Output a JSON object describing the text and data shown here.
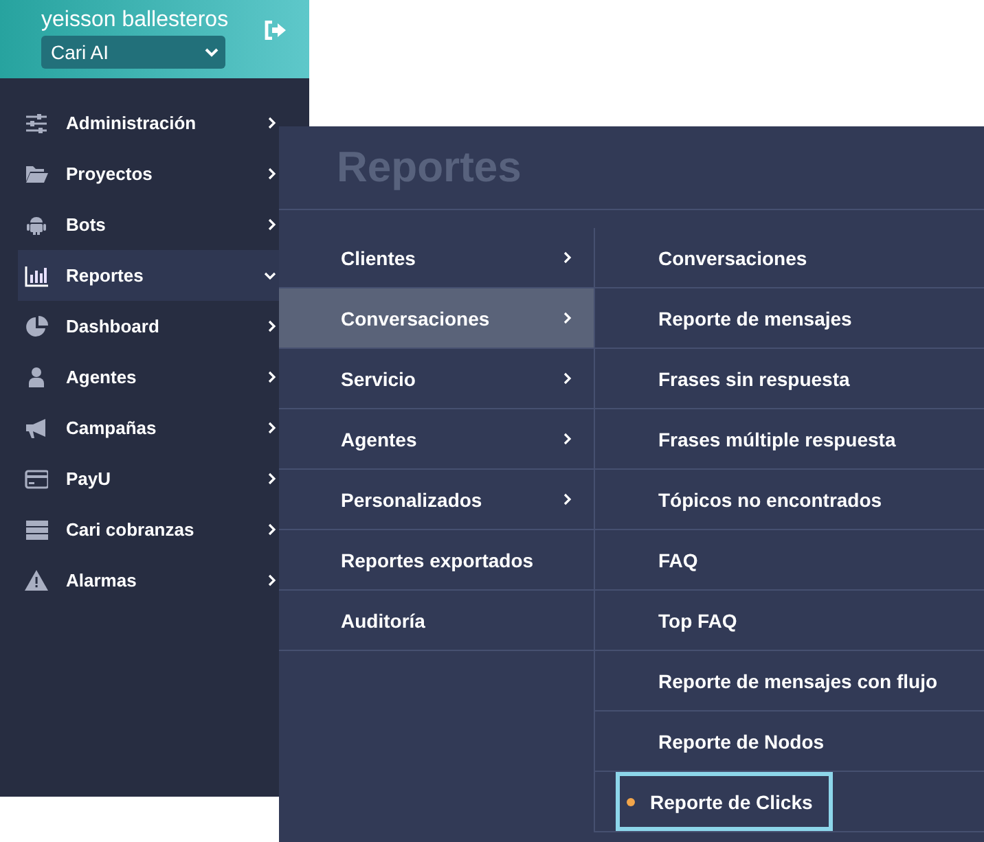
{
  "user": {
    "name": "yeisson ballesteros",
    "workspace": "Cari AI"
  },
  "sidebar": {
    "items": [
      {
        "label": "Administración",
        "selected": false,
        "expanded": false
      },
      {
        "label": "Proyectos",
        "selected": false,
        "expanded": false
      },
      {
        "label": "Bots",
        "selected": false,
        "expanded": false
      },
      {
        "label": "Reportes",
        "selected": true,
        "expanded": true
      },
      {
        "label": "Dashboard",
        "selected": false,
        "expanded": false
      },
      {
        "label": "Agentes",
        "selected": false,
        "expanded": false
      },
      {
        "label": "Campañas",
        "selected": false,
        "expanded": false
      },
      {
        "label": "PayU",
        "selected": false,
        "expanded": false
      },
      {
        "label": "Cari cobranzas",
        "selected": false,
        "expanded": false
      },
      {
        "label": "Alarmas",
        "selected": false,
        "expanded": false
      }
    ]
  },
  "flyout": {
    "title": "Reportes",
    "categories": [
      {
        "label": "Clientes",
        "submenu": true,
        "selected": false
      },
      {
        "label": "Conversaciones",
        "submenu": true,
        "selected": true
      },
      {
        "label": "Servicio",
        "submenu": true,
        "selected": false
      },
      {
        "label": "Agentes",
        "submenu": true,
        "selected": false
      },
      {
        "label": "Personalizados",
        "submenu": true,
        "selected": false
      },
      {
        "label": "Reportes exportados",
        "submenu": false,
        "selected": false
      },
      {
        "label": "Auditoría",
        "submenu": false,
        "selected": false
      }
    ],
    "reports": [
      {
        "label": "Conversaciones",
        "selected": false,
        "focused": false
      },
      {
        "label": "Reporte de mensajes",
        "selected": false,
        "focused": false
      },
      {
        "label": "Frases sin respuesta",
        "selected": false,
        "focused": false
      },
      {
        "label": "Frases múltiple respuesta",
        "selected": false,
        "focused": false
      },
      {
        "label": "Tópicos no encontrados",
        "selected": false,
        "focused": false
      },
      {
        "label": "FAQ",
        "selected": false,
        "focused": false
      },
      {
        "label": "Top FAQ",
        "selected": false,
        "focused": false
      },
      {
        "label": "Reporte de mensajes con flujo",
        "selected": false,
        "focused": false
      },
      {
        "label": "Reporte de Nodos",
        "selected": false,
        "focused": false
      },
      {
        "label": "Reporte de Clicks",
        "selected": true,
        "focused": true
      }
    ]
  }
}
